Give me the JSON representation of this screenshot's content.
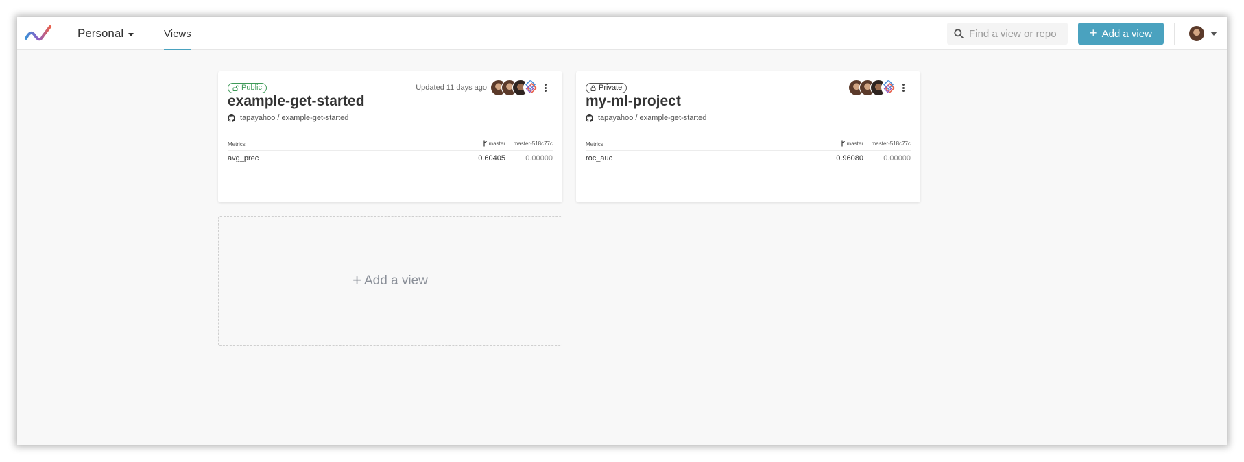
{
  "header": {
    "logo_name": "dvc-studio-logo",
    "workspace_label": "Personal",
    "nav_tab_label": "Views",
    "search_placeholder": "Find a view or repo",
    "add_view_label": "Add a view",
    "accent_color": "#4aa2bf"
  },
  "projects": [
    {
      "visibility": "Public",
      "visibility_color": "#3e9a58",
      "updated_text": "Updated 11 days ago",
      "title": "example-get-started",
      "repo": "tapayahoo / example-get-started",
      "metrics_header": "Metrics",
      "branch": "master",
      "commit": "master-518c77c",
      "metric_name": "avg_prec",
      "metric_value": "0.60405",
      "metric_commit_value": "0.00000"
    },
    {
      "visibility": "Private",
      "visibility_color": "#555555",
      "updated_text": "",
      "title": "my-ml-project",
      "repo": "tapayahoo / example-get-started",
      "metrics_header": "Metrics",
      "branch": "master",
      "commit": "master-518c77c",
      "metric_name": "roc_auc",
      "metric_value": "0.96080",
      "metric_commit_value": "0.00000"
    }
  ],
  "add_card_label": "Add a view"
}
